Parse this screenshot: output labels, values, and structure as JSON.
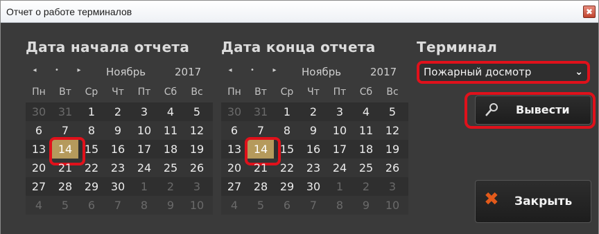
{
  "window": {
    "title": "Отчет о работе терминалов",
    "close_glyph": "✖"
  },
  "start_calendar": {
    "heading": "Дата начала отчета",
    "nav": [
      "◂",
      "•",
      "▸"
    ],
    "month": "Ноябрь",
    "year": "2017",
    "weekdays": [
      "Пн",
      "Вт",
      "Ср",
      "Чт",
      "Пт",
      "Сб",
      "Вс"
    ],
    "weeks": [
      [
        {
          "d": "30",
          "m": true
        },
        {
          "d": "31",
          "m": true
        },
        {
          "d": "1"
        },
        {
          "d": "2"
        },
        {
          "d": "3"
        },
        {
          "d": "4"
        },
        {
          "d": "5"
        }
      ],
      [
        {
          "d": "6"
        },
        {
          "d": "7"
        },
        {
          "d": "8"
        },
        {
          "d": "9"
        },
        {
          "d": "10"
        },
        {
          "d": "11"
        },
        {
          "d": "12"
        }
      ],
      [
        {
          "d": "13"
        },
        {
          "d": "14",
          "sel": true
        },
        {
          "d": "15"
        },
        {
          "d": "16"
        },
        {
          "d": "17"
        },
        {
          "d": "18"
        },
        {
          "d": "19"
        }
      ],
      [
        {
          "d": "20"
        },
        {
          "d": "21"
        },
        {
          "d": "22"
        },
        {
          "d": "23"
        },
        {
          "d": "24"
        },
        {
          "d": "25"
        },
        {
          "d": "26"
        }
      ],
      [
        {
          "d": "27"
        },
        {
          "d": "28"
        },
        {
          "d": "29"
        },
        {
          "d": "30"
        },
        {
          "d": "1",
          "m": true
        },
        {
          "d": "2",
          "m": true
        },
        {
          "d": "3",
          "m": true
        }
      ],
      [
        {
          "d": "4",
          "m": true
        },
        {
          "d": "5",
          "m": true
        },
        {
          "d": "6",
          "m": true
        },
        {
          "d": "7",
          "m": true
        },
        {
          "d": "8",
          "m": true
        },
        {
          "d": "9",
          "m": true
        },
        {
          "d": "10",
          "m": true
        }
      ]
    ]
  },
  "end_calendar": {
    "heading": "Дата конца отчета",
    "nav": [
      "◂",
      "•",
      "▸"
    ],
    "month": "Ноябрь",
    "year": "2017",
    "weekdays": [
      "Пн",
      "Вт",
      "Ср",
      "Чт",
      "Пт",
      "Сб",
      "Вс"
    ],
    "weeks": [
      [
        {
          "d": "30",
          "m": true
        },
        {
          "d": "31",
          "m": true
        },
        {
          "d": "1"
        },
        {
          "d": "2"
        },
        {
          "d": "3"
        },
        {
          "d": "4"
        },
        {
          "d": "5"
        }
      ],
      [
        {
          "d": "6"
        },
        {
          "d": "7"
        },
        {
          "d": "8"
        },
        {
          "d": "9"
        },
        {
          "d": "10"
        },
        {
          "d": "11"
        },
        {
          "d": "12"
        }
      ],
      [
        {
          "d": "13"
        },
        {
          "d": "14",
          "sel": true
        },
        {
          "d": "15"
        },
        {
          "d": "16"
        },
        {
          "d": "17"
        },
        {
          "d": "18"
        },
        {
          "d": "19"
        }
      ],
      [
        {
          "d": "20"
        },
        {
          "d": "21"
        },
        {
          "d": "22"
        },
        {
          "d": "23"
        },
        {
          "d": "24"
        },
        {
          "d": "25"
        },
        {
          "d": "26"
        }
      ],
      [
        {
          "d": "27"
        },
        {
          "d": "28"
        },
        {
          "d": "29"
        },
        {
          "d": "30"
        },
        {
          "d": "1",
          "m": true
        },
        {
          "d": "2",
          "m": true
        },
        {
          "d": "3",
          "m": true
        }
      ],
      [
        {
          "d": "4",
          "m": true
        },
        {
          "d": "5",
          "m": true
        },
        {
          "d": "6",
          "m": true
        },
        {
          "d": "7",
          "m": true
        },
        {
          "d": "8",
          "m": true
        },
        {
          "d": "9",
          "m": true
        },
        {
          "d": "10",
          "m": true
        }
      ]
    ]
  },
  "terminal": {
    "heading": "Терминал",
    "selected": "Пожарный досмотр",
    "chevron": "⌄"
  },
  "actions": {
    "print_label": "Вывести",
    "print_icon": "magnifier-icon",
    "close_label": "Закрыть",
    "close_icon_glyph": "✖"
  },
  "colors": {
    "highlight": "#e0111b",
    "selected_day": "#b59a5c",
    "background": "#3a3a3a"
  }
}
